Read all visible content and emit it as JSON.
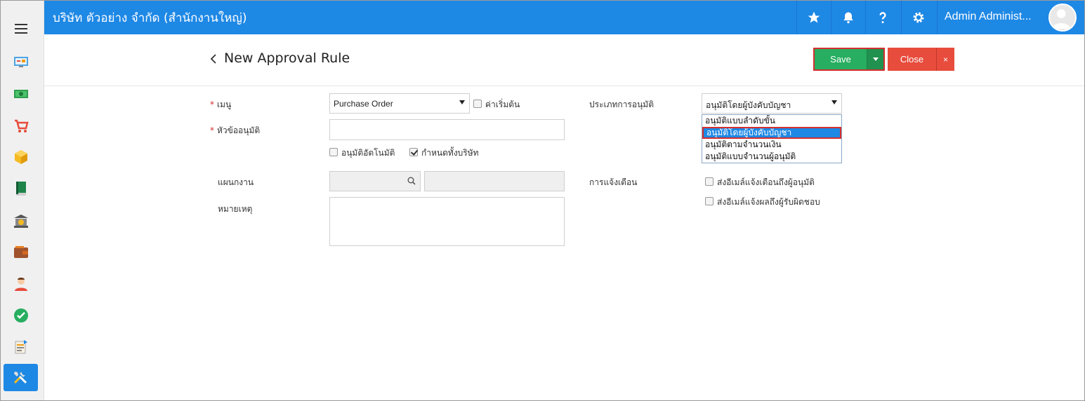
{
  "header": {
    "company": "บริษัท ตัวอย่าง จำกัด (สำนักงานใหญ่)",
    "user_name": "Admin Administ..."
  },
  "page": {
    "title": "New Approval Rule"
  },
  "toolbar": {
    "save_label": "Save",
    "close_label": "Close",
    "close_x": "×"
  },
  "form": {
    "menu_label": "เมนู",
    "menu_value": "Purchase Order",
    "default_label": "ค่าเริ่มต้น",
    "subject_label": "หัวข้ออนุมัติ",
    "subject_value": "",
    "auto_approve_label": "อนุมัติอัตโนมัติ",
    "company_wide_label": "กำหนดทั้งบริษัท",
    "department_label": "แผนกงาน",
    "note_label": "หมายเหตุ",
    "approval_type_label": "ประเภทการอนุมัติ",
    "approval_type_value": "อนุมัติโดยผู้บังคับบัญชา",
    "approval_type_options": [
      "อนุมัติแบบลำดับขั้น",
      "อนุมัติโดยผู้บังคับบัญชา",
      "อนุมัติตามจำนวนเงิน",
      "อนุมัติแบบจำนวนผู้อนุมัติ"
    ],
    "notify_label": "การแจ้งเตือน",
    "notify_approver_label": "ส่งอีเมล์แจ้งเตือนถึงผู้อนุมัติ",
    "notify_owner_label": "ส่งอีเมล์แจ้งผลถึงผู้รับผิดชอบ"
  },
  "colors": {
    "primary": "#1e88e5",
    "save": "#27ae60",
    "close": "#e74c3c",
    "highlight": "#d32f2f"
  }
}
